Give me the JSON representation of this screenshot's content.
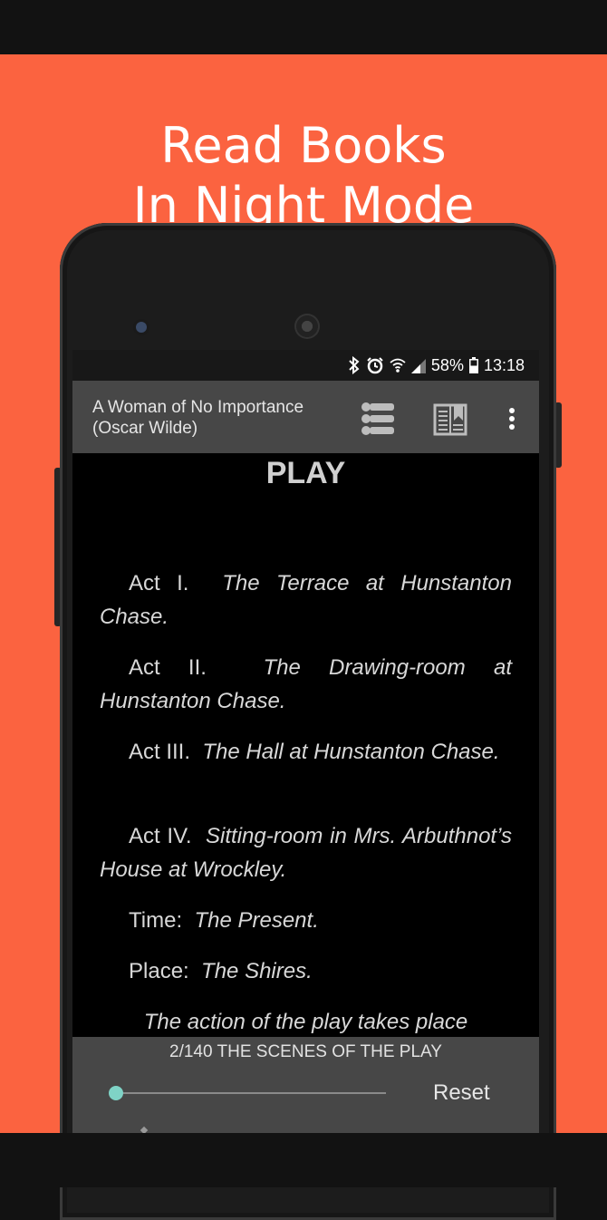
{
  "promo": {
    "headline_line1": "Read Books",
    "headline_line2": "In Night Mode",
    "background_color": "#fb6340"
  },
  "statusbar": {
    "battery": "58%",
    "time": "13:18",
    "icons": [
      "bluetooth-icon",
      "alarm-icon",
      "wifi-icon",
      "signal-icon",
      "battery-icon"
    ]
  },
  "appbar": {
    "title_line1": "A Woman of No Importance",
    "title_line2": "(Oscar Wilde)",
    "icons": [
      "table-of-contents-icon",
      "bookmark-icon",
      "more-vert-icon"
    ]
  },
  "reader": {
    "heading": "PLAY",
    "paragraphs": [
      {
        "label": "Act I.",
        "desc": "The Terrace at Hunstanton Chase."
      },
      {
        "label": "Act II.",
        "desc": "The Drawing-room at Hunstanton Chase."
      },
      {
        "label": "Act III.",
        "desc": "The Hall at Hunstanton Chase."
      },
      {
        "label": "Act IV.",
        "desc": "Sitting-room in Mrs. Arbuthnot’s House at Wrockley."
      },
      {
        "label": "Time:",
        "desc": "The Present."
      },
      {
        "label": "Place:",
        "desc": "The Shires."
      }
    ],
    "partial_line": "The action of the play takes place"
  },
  "bottom_panel": {
    "page_info": "2/140  THE SCENES OF THE PLAY",
    "progress_fraction": 0.007,
    "reset_label": "Reset",
    "accent_color": "#7fd3c6"
  }
}
